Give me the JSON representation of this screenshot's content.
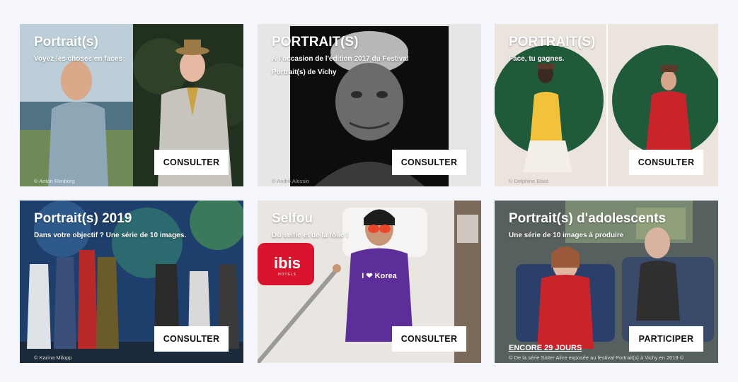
{
  "cards": [
    {
      "title": "Portrait(s)",
      "subtitle": "Voyez les choses en faces",
      "button": "CONSULTER",
      "credit": "© Anton Renborg"
    },
    {
      "title": "PORTRAIT(S)",
      "subtitle": "À l'occasion de l'édition 2017 du Festival Portrait(s) de Vichy",
      "button": "CONSULTER",
      "credit": "© André Alessio"
    },
    {
      "title": "PORTRAIT(S)",
      "subtitle": "Face, tu gagnes.",
      "button": "CONSULTER",
      "credit": "© Delphine Blast"
    },
    {
      "title": "Portrait(s) 2019",
      "subtitle": "Dans votre objectif ? Une série de 10 images.",
      "button": "CONSULTER",
      "credit": "© Karina Milopp"
    },
    {
      "title": "Selfou",
      "subtitle": "Du selfie et de la folie !",
      "button": "CONSULTER",
      "credit": "",
      "pillow_text": "ibis",
      "pillow_subtext": "HOTELS",
      "shirt_text": "I ❤ Korea"
    },
    {
      "title": "Portrait(s) d'adolescents",
      "subtitle": "Une série de 10 images à produire",
      "button": "PARTICIPER",
      "countdown": "ENCORE 29 JOURS",
      "credit": "© De la série Sister Alice exposée au festival Portrait(s) à Vichy en 2019 ©"
    }
  ]
}
